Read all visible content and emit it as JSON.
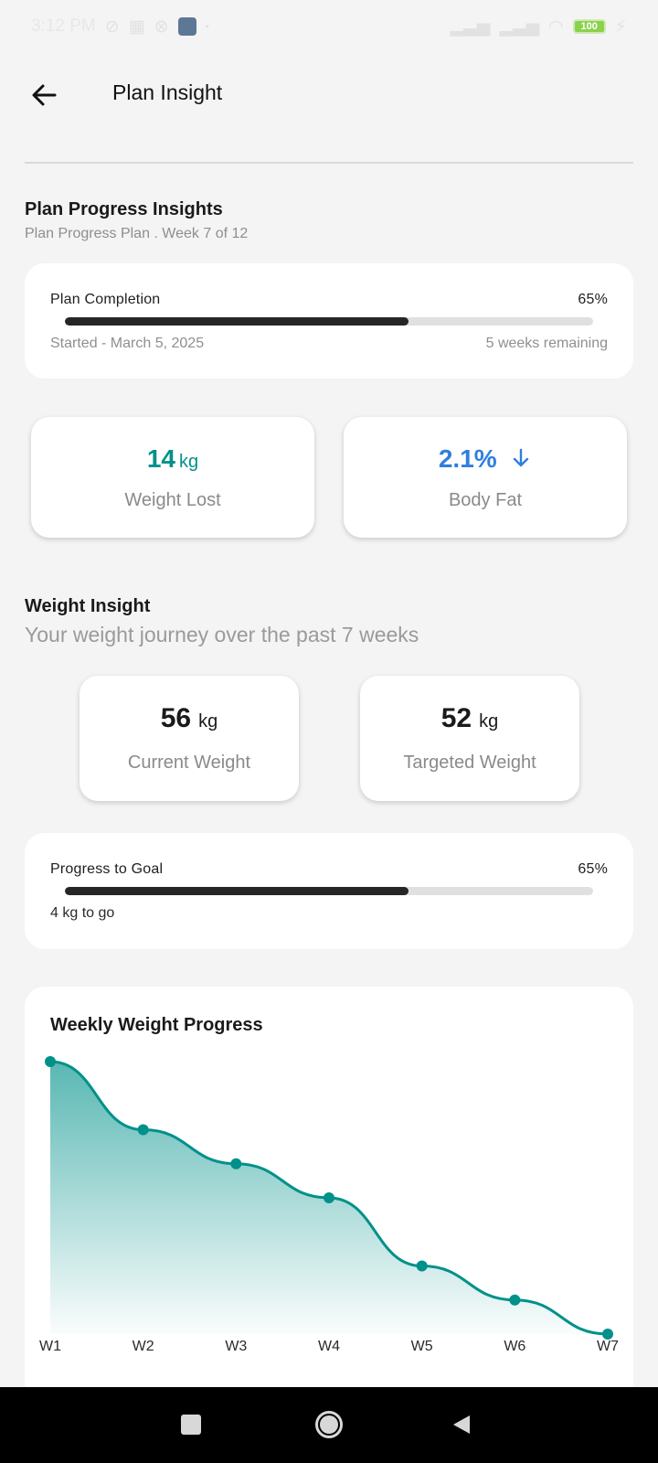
{
  "status_bar": {
    "time": "3:12 PM",
    "battery": "100"
  },
  "app_bar": {
    "title": "Plan Insight"
  },
  "plan_progress": {
    "title": "Plan Progress Insights",
    "subtitle": "Plan Progress Plan . Week 7 of 12",
    "completion_label": "Plan Completion",
    "completion_percent_text": "65%",
    "completion_fraction": 0.65,
    "started": "Started - March 5, 2025",
    "remaining": "5 weeks remaining"
  },
  "stats": {
    "weight_lost_value": "14",
    "weight_lost_unit": "kg",
    "weight_lost_label": "Weight Lost",
    "body_fat_value": "2.1%",
    "body_fat_label": "Body Fat"
  },
  "weight_insight": {
    "title": "Weight Insight",
    "subtitle": "Your weight journey over the past 7 weeks",
    "current_value": "56",
    "current_unit": "kg",
    "current_label": "Current Weight",
    "target_value": "52",
    "target_unit": "kg",
    "target_label": "Targeted Weight"
  },
  "goal_progress": {
    "label": "Progress to Goal",
    "percent_text": "65%",
    "fraction": 0.65,
    "remaining": "4 kg to go"
  },
  "colors": {
    "accent_teal": "#00918a",
    "accent_blue": "#2f7ee0",
    "bar_fill": "#262626",
    "bar_track": "#e0e0e0"
  },
  "chart_data": {
    "type": "area",
    "title": "Weekly Weight Progress",
    "categories": [
      "W1",
      "W2",
      "W3",
      "W4",
      "W5",
      "W6",
      "W7"
    ],
    "values": [
      100,
      80,
      70,
      60,
      40,
      30,
      20
    ],
    "ylim": [
      20,
      100
    ],
    "grid": false
  }
}
